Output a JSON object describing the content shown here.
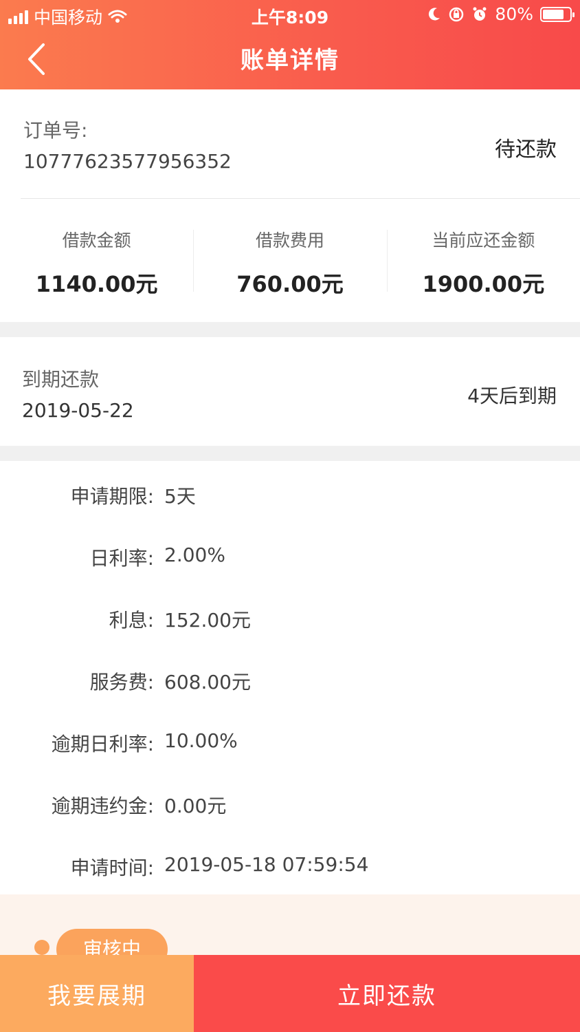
{
  "status_bar": {
    "carrier": "中国移动",
    "time": "上午8:09",
    "battery_text": "80%",
    "battery_level": 0.8
  },
  "header": {
    "title": "账单详情",
    "back_icon": "chevron-left-icon"
  },
  "order": {
    "label": "订单号:",
    "number": "10777623577956352",
    "status": "待还款"
  },
  "amounts": [
    {
      "label": "借款金额",
      "value": "1140.00元"
    },
    {
      "label": "借款费用",
      "value": "760.00元"
    },
    {
      "label": "当前应还金额",
      "value": "1900.00元"
    }
  ],
  "due": {
    "label": "到期还款",
    "date": "2019-05-22",
    "remaining": "4天后到期"
  },
  "details": [
    {
      "key": "申请期限:",
      "value": "5天"
    },
    {
      "key": "日利率:",
      "value": "2.00%"
    },
    {
      "key": "利息:",
      "value": "152.00元"
    },
    {
      "key": "服务费:",
      "value": "608.00元"
    },
    {
      "key": "逾期日利率:",
      "value": "10.00%"
    },
    {
      "key": "逾期违约金:",
      "value": "0.00元"
    },
    {
      "key": "申请时间:",
      "value": "2019-05-18 07:59:54"
    }
  ],
  "progress": {
    "step_label": "审核中"
  },
  "actions": {
    "extend_label": "我要展期",
    "pay_label": "立即还款"
  },
  "colors": {
    "header_gradient_start": "#fb7b4e",
    "header_gradient_end": "#f84a4a",
    "extend_button": "#fcaa5f",
    "pay_button": "#fa4b4a",
    "progress_bg": "#fdf3ec"
  }
}
